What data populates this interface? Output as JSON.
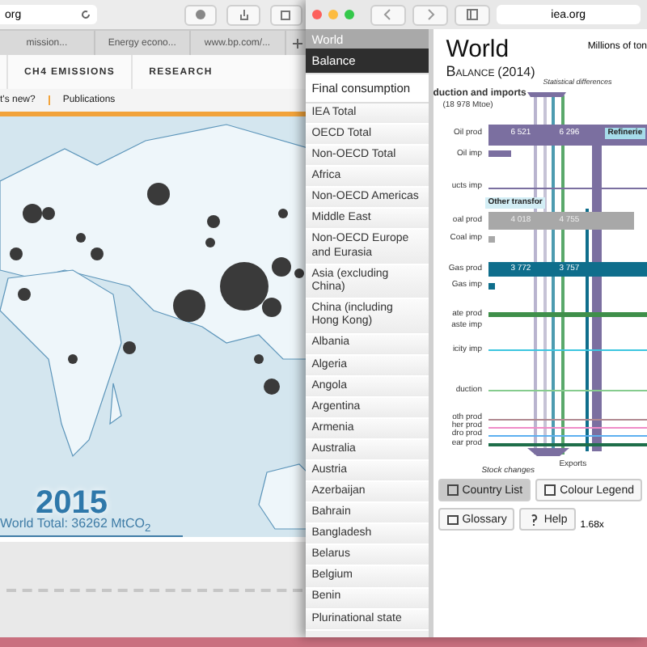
{
  "left_window": {
    "address": "org",
    "tabs": [
      {
        "label": "mission...",
        "selected": false
      },
      {
        "label": "Energy econo...",
        "selected": false
      },
      {
        "label": "www.bp.com/...",
        "selected": false
      }
    ],
    "nav": [
      {
        "label": "CH4 EMISSIONS"
      },
      {
        "label": "RESEARCH"
      }
    ],
    "subnav": [
      {
        "label": "t's new?"
      },
      {
        "label": "Publications"
      }
    ],
    "map": {
      "year": "2015",
      "total": "World Total: 36262 MtCO$_{2}$"
    }
  },
  "right_window": {
    "address": "iea.org",
    "sidebar": {
      "header": "World",
      "views": [
        {
          "label": "Balance",
          "selected": true
        },
        {
          "label": "Final consumption",
          "selected": false
        }
      ],
      "items": [
        "IEA Total",
        "OECD Total",
        "Non-OECD Total",
        "Africa",
        "Non-OECD Americas",
        "Middle East",
        "Non-OECD Europe and Eurasia",
        "Asia (excluding China)",
        "China (including Hong Kong)",
        "Albania",
        "Algeria",
        "Angola",
        "Argentina",
        "Armenia",
        "Australia",
        "Austria",
        "Azerbaijan",
        "Bahrain",
        "Bangladesh",
        "Belarus",
        "Belgium",
        "Benin",
        "Plurinational state"
      ]
    },
    "title": "World",
    "subtitle": "Balance",
    "subtitle_year": "(2014)",
    "units": "Millions of ton",
    "sankey": {
      "note": "Statistical differences",
      "heading": "duction and imports",
      "total": "(18 978 Mtoe)",
      "rows": [
        {
          "label": "Oil prod"
        },
        {
          "label": "Oil imp"
        },
        {
          "label": "ucts imp"
        },
        {
          "label": "oal prod"
        },
        {
          "label": "Coal imp"
        },
        {
          "label": "Gas prod"
        },
        {
          "label": "Gas imp"
        },
        {
          "label": "ate prod"
        },
        {
          "label": "aste imp"
        },
        {
          "label": "icity imp"
        },
        {
          "label": "duction"
        },
        {
          "label": "oth prod"
        },
        {
          "label": "her prod"
        },
        {
          "label": "dro prod"
        },
        {
          "label": "ear prod"
        }
      ],
      "values": [
        "6 521",
        "6 296",
        "4 018",
        "4 755",
        "3 772",
        "3 757"
      ],
      "nodes": [
        "Refinerie",
        "Other transfor"
      ],
      "exports": "Exports",
      "stock": "Stock changes"
    },
    "buttons": [
      {
        "label": "Country List",
        "selected": true
      },
      {
        "label": "Colour Legend",
        "selected": false
      },
      {
        "label": "Glossary",
        "selected": false
      },
      {
        "label": "Help",
        "selected": false
      }
    ],
    "speed": "1.68x"
  }
}
